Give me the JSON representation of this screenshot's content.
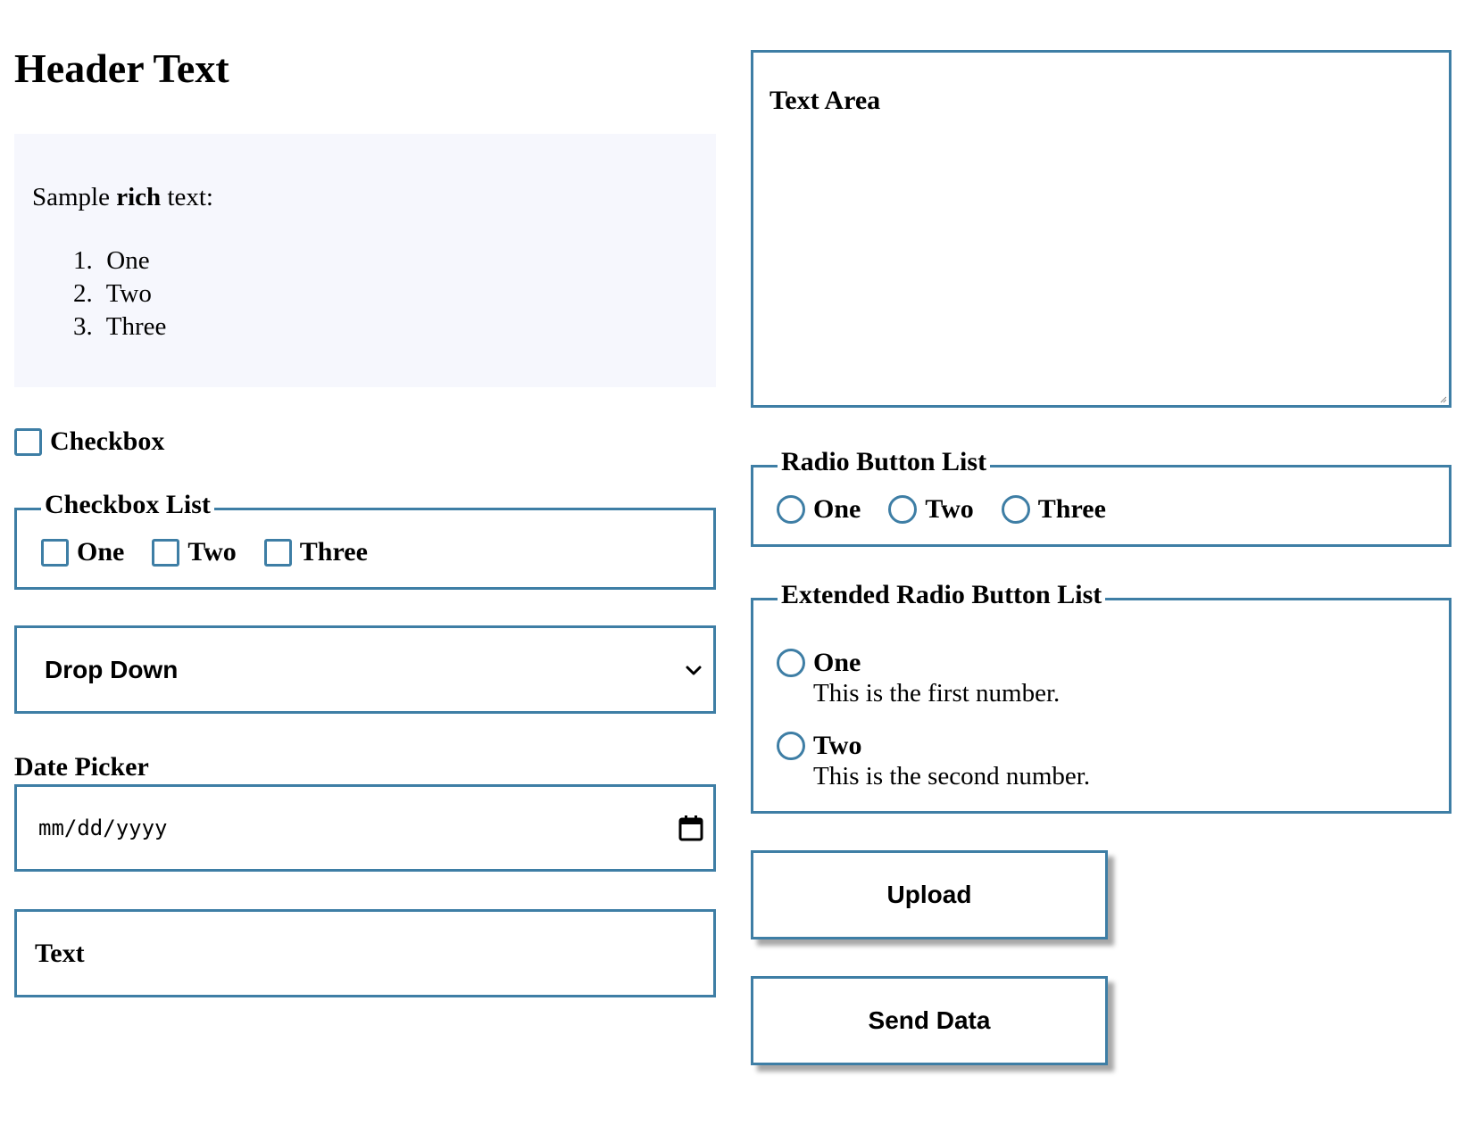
{
  "header": {
    "title": "Header Text"
  },
  "rich_text": {
    "intro_before": "Sample ",
    "intro_bold": "rich",
    "intro_after": " text:",
    "items": [
      {
        "num": "1.",
        "label": "One"
      },
      {
        "num": "2.",
        "label": "Two"
      },
      {
        "num": "3.",
        "label": "Three"
      }
    ]
  },
  "checkbox": {
    "label": "Checkbox",
    "checked": false
  },
  "checkbox_list": {
    "legend": "Checkbox List",
    "options": [
      {
        "label": "One",
        "checked": false
      },
      {
        "label": "Two",
        "checked": false
      },
      {
        "label": "Three",
        "checked": false
      }
    ]
  },
  "dropdown": {
    "value": "Drop Down"
  },
  "date_picker": {
    "label": "Date Picker",
    "placeholder": "mm/dd/yyyy"
  },
  "text_input": {
    "value": "Text"
  },
  "text_area": {
    "value": "Text Area"
  },
  "radio_list": {
    "legend": "Radio Button List",
    "options": [
      {
        "label": "One"
      },
      {
        "label": "Two"
      },
      {
        "label": "Three"
      }
    ]
  },
  "extended_radio_list": {
    "legend": "Extended Radio Button List",
    "options": [
      {
        "label": "One",
        "description": "This is the first number."
      },
      {
        "label": "Two",
        "description": "This is the second number."
      }
    ]
  },
  "buttons": {
    "upload": "Upload",
    "send": "Send Data"
  },
  "colors": {
    "accent_border": "#3e7ea5",
    "rich_bg": "#f6f7fd"
  }
}
